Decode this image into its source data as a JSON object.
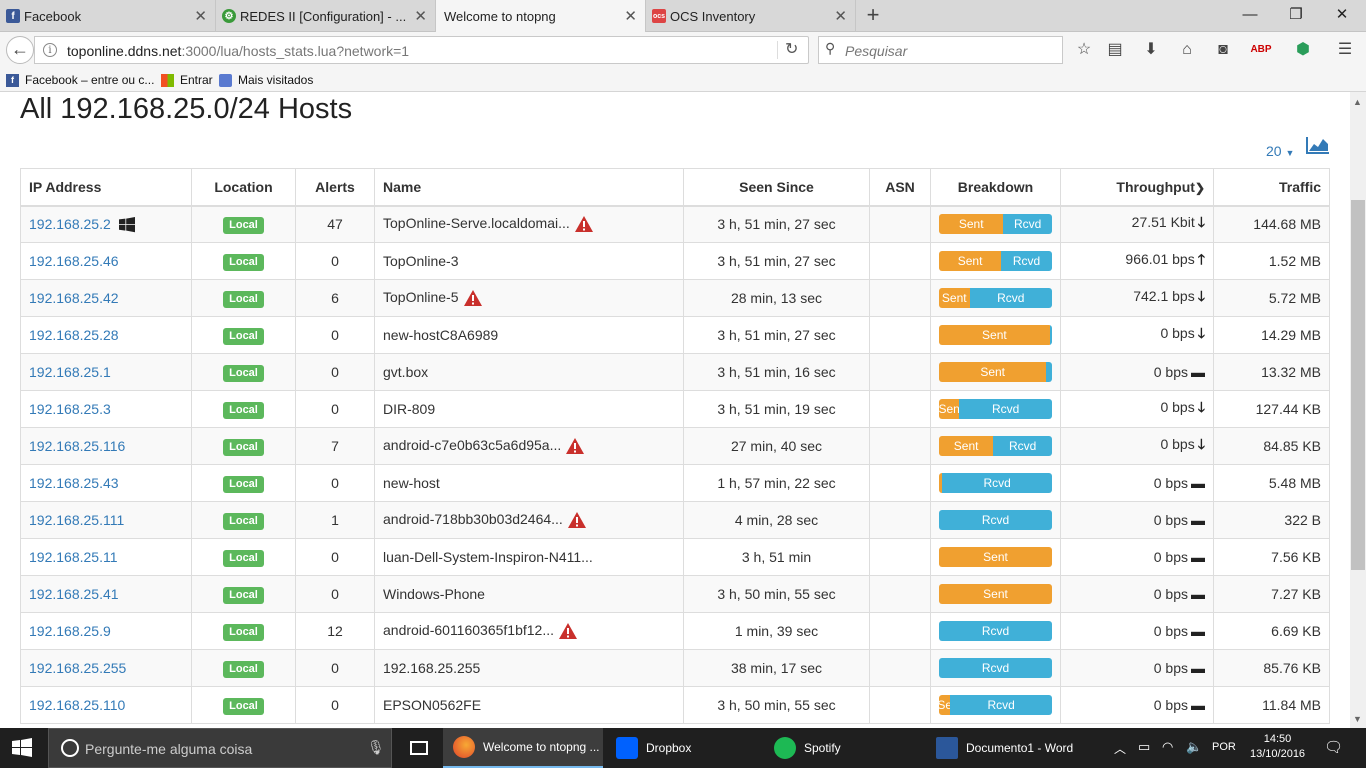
{
  "browser": {
    "tabs": [
      {
        "title": "Facebook",
        "icon": "facebook-icon",
        "active": false
      },
      {
        "title": "REDES II [Configuration] - ...",
        "icon": "redes-icon",
        "active": false
      },
      {
        "title": "Welcome to ntopng",
        "icon": "",
        "active": true
      },
      {
        "title": "OCS Inventory",
        "icon": "ocs-icon",
        "active": false
      }
    ],
    "url_host": "toponline.ddns.net",
    "url_rest": ":3000/lua/hosts_stats.lua?network=1",
    "search_placeholder": "Pesquisar",
    "bookmarks": [
      {
        "label": "Facebook – entre ou c...",
        "icon": "facebook-icon"
      },
      {
        "label": "Entrar",
        "icon": "windows-icon"
      },
      {
        "label": "Mais visitados",
        "icon": "firefox-icon"
      }
    ]
  },
  "page": {
    "title": "All 192.168.25.0/24 Hosts",
    "page_size": "20",
    "columns": [
      "IP Address",
      "Location",
      "Alerts",
      "Name",
      "Seen Since",
      "ASN",
      "Breakdown",
      "Throughput",
      "Traffic"
    ],
    "hosts": [
      {
        "ip": "192.168.25.2",
        "os_icon": "windows-logo-icon",
        "location": "Local",
        "alerts": "47",
        "name": "TopOnline-Serve.localdomai...",
        "warn": true,
        "seen": "3 h, 51 min, 27 sec",
        "asn": "",
        "sent_pct": 57,
        "sent_label": "Sent",
        "rcvd_label": "Rcvd",
        "throughput": "27.51 Kbit",
        "trend": "down",
        "traffic": "144.68 MB"
      },
      {
        "ip": "192.168.25.46",
        "os_icon": "",
        "location": "Local",
        "alerts": "0",
        "name": "TopOnline-3",
        "warn": false,
        "seen": "3 h, 51 min, 27 sec",
        "asn": "",
        "sent_pct": 55,
        "sent_label": "Sent",
        "rcvd_label": "Rcvd",
        "throughput": "966.01 bps",
        "trend": "up",
        "traffic": "1.52 MB"
      },
      {
        "ip": "192.168.25.42",
        "os_icon": "",
        "location": "Local",
        "alerts": "6",
        "name": "TopOnline-5",
        "warn": true,
        "seen": "28 min, 13 sec",
        "asn": "",
        "sent_pct": 27,
        "sent_label": "Sent",
        "rcvd_label": "Rcvd",
        "throughput": "742.1 bps",
        "trend": "down",
        "traffic": "5.72 MB"
      },
      {
        "ip": "192.168.25.28",
        "os_icon": "",
        "location": "Local",
        "alerts": "0",
        "name": "new-hostC8A6989",
        "warn": false,
        "seen": "3 h, 51 min, 27 sec",
        "asn": "",
        "sent_pct": 98,
        "sent_label": "Sent",
        "rcvd_label": "",
        "throughput": "0 bps",
        "trend": "down",
        "traffic": "14.29 MB"
      },
      {
        "ip": "192.168.25.1",
        "os_icon": "",
        "location": "Local",
        "alerts": "0",
        "name": "gvt.box",
        "warn": false,
        "seen": "3 h, 51 min, 16 sec",
        "asn": "",
        "sent_pct": 95,
        "sent_label": "Sent",
        "rcvd_label": "",
        "throughput": "0 bps",
        "trend": "flat",
        "traffic": "13.32 MB"
      },
      {
        "ip": "192.168.25.3",
        "os_icon": "",
        "location": "Local",
        "alerts": "0",
        "name": "DIR-809",
        "warn": false,
        "seen": "3 h, 51 min, 19 sec",
        "asn": "",
        "sent_pct": 18,
        "sent_label": "Sen",
        "rcvd_label": "Rcvd",
        "throughput": "0 bps",
        "trend": "down",
        "traffic": "127.44 KB"
      },
      {
        "ip": "192.168.25.116",
        "os_icon": "",
        "location": "Local",
        "alerts": "7",
        "name": "android-c7e0b63c5a6d95a...",
        "warn": true,
        "seen": "27 min, 40 sec",
        "asn": "",
        "sent_pct": 48,
        "sent_label": "Sent",
        "rcvd_label": "Rcvd",
        "throughput": "0 bps",
        "trend": "down",
        "traffic": "84.85 KB"
      },
      {
        "ip": "192.168.25.43",
        "os_icon": "",
        "location": "Local",
        "alerts": "0",
        "name": "new-host",
        "warn": false,
        "seen": "1 h, 57 min, 22 sec",
        "asn": "",
        "sent_pct": 3,
        "sent_label": "",
        "rcvd_label": "Rcvd",
        "throughput": "0 bps",
        "trend": "flat",
        "traffic": "5.48 MB"
      },
      {
        "ip": "192.168.25.111",
        "os_icon": "",
        "location": "Local",
        "alerts": "1",
        "name": "android-718bb30b03d2464...",
        "warn": true,
        "seen": "4 min, 28 sec",
        "asn": "",
        "sent_pct": 0,
        "sent_label": "",
        "rcvd_label": "Rcvd",
        "throughput": "0 bps",
        "trend": "flat",
        "traffic": "322 B"
      },
      {
        "ip": "192.168.25.11",
        "os_icon": "",
        "location": "Local",
        "alerts": "0",
        "name": "luan-Dell-System-Inspiron-N411...",
        "warn": false,
        "seen": "3 h, 51 min",
        "asn": "",
        "sent_pct": 100,
        "sent_label": "Sent",
        "rcvd_label": "",
        "throughput": "0 bps",
        "trend": "flat",
        "traffic": "7.56 KB"
      },
      {
        "ip": "192.168.25.41",
        "os_icon": "",
        "location": "Local",
        "alerts": "0",
        "name": "Windows-Phone",
        "warn": false,
        "seen": "3 h, 50 min, 55 sec",
        "asn": "",
        "sent_pct": 100,
        "sent_label": "Sent",
        "rcvd_label": "",
        "throughput": "0 bps",
        "trend": "flat",
        "traffic": "7.27 KB"
      },
      {
        "ip": "192.168.25.9",
        "os_icon": "",
        "location": "Local",
        "alerts": "12",
        "name": "android-601160365f1bf12...",
        "warn": true,
        "seen": "1 min, 39 sec",
        "asn": "",
        "sent_pct": 0,
        "sent_label": "",
        "rcvd_label": "Rcvd",
        "throughput": "0 bps",
        "trend": "flat",
        "traffic": "6.69 KB"
      },
      {
        "ip": "192.168.25.255",
        "os_icon": "",
        "location": "Local",
        "alerts": "0",
        "name": "192.168.25.255",
        "warn": false,
        "seen": "38 min, 17 sec",
        "asn": "",
        "sent_pct": 0,
        "sent_label": "",
        "rcvd_label": "Rcvd",
        "throughput": "0 bps",
        "trend": "flat",
        "traffic": "85.76 KB"
      },
      {
        "ip": "192.168.25.110",
        "os_icon": "",
        "location": "Local",
        "alerts": "0",
        "name": "EPSON0562FE",
        "warn": false,
        "seen": "3 h, 50 min, 55 sec",
        "asn": "",
        "sent_pct": 10,
        "sent_label": "Se",
        "rcvd_label": "Rcvd",
        "throughput": "0 bps",
        "trend": "flat",
        "traffic": "11.84 MB"
      }
    ]
  },
  "taskbar": {
    "search_placeholder": "Pergunte-me alguma coisa",
    "apps": [
      {
        "label": "Welcome to ntopng ...",
        "icon": "firefox-icon",
        "active": true
      },
      {
        "label": "Dropbox",
        "icon": "dropbox-icon",
        "active": false
      },
      {
        "label": "Spotify",
        "icon": "spotify-icon",
        "active": false
      },
      {
        "label": "Documento1 - Word",
        "icon": "word-icon",
        "active": false
      }
    ],
    "language": "POR",
    "time": "14:50",
    "date": "13/10/2016"
  },
  "colors": {
    "sent": "#f0a030",
    "rcvd": "#40b0d8",
    "local_badge": "#5cb85c",
    "link": "#337ab7",
    "warning": "#c9302c"
  }
}
